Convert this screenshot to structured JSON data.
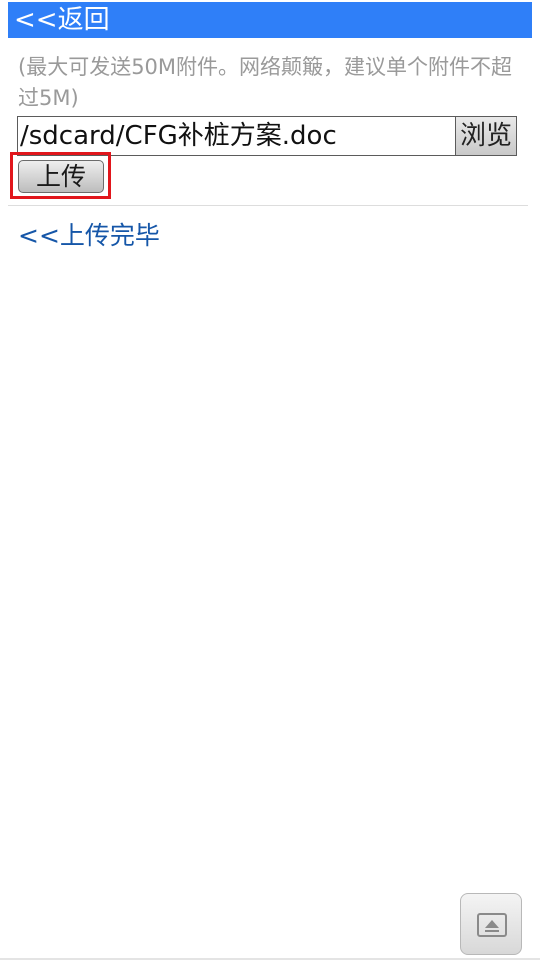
{
  "header": {
    "back_label": "<<返回",
    "background_color": "#2f7ff8"
  },
  "upload_form": {
    "hint": "(最大可发送50M附件。网络颠簸，建议单个附件不超过5M)",
    "file_path": "/sdcard/CFG补桩方案.doc",
    "browse_label": "浏览",
    "upload_label": "上传",
    "highlight_color": "#e1161c"
  },
  "footer_link": {
    "done_label": "<<上传完毕",
    "link_color": "#1556a8"
  },
  "floating_button": {
    "icon": "window-eject-icon"
  }
}
